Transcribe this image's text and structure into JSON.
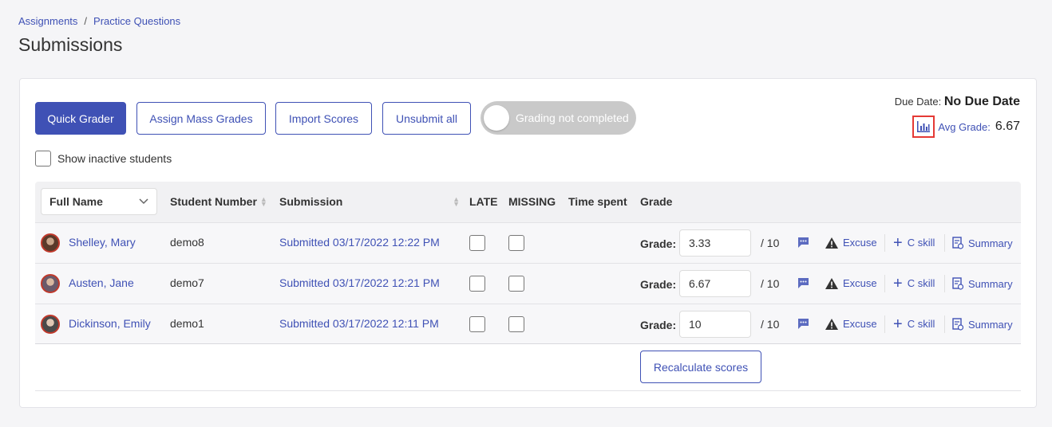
{
  "breadcrumb": {
    "item1": "Assignments",
    "sep": "/",
    "item2": "Practice Questions"
  },
  "page": {
    "title": "Submissions"
  },
  "toolbar": {
    "quick_grader": "Quick Grader",
    "assign_mass": "Assign Mass Grades",
    "import_scores": "Import Scores",
    "unsubmit_all": "Unsubmit all",
    "toggle_label": "Grading not completed"
  },
  "due": {
    "label": "Due Date:",
    "value": "No Due Date"
  },
  "avg": {
    "label": "Avg Grade:",
    "value": "6.67"
  },
  "inactive_label": "Show inactive students",
  "columns": {
    "full_name": "Full Name",
    "student_number": "Student Number",
    "submission": "Submission",
    "late": "LATE",
    "missing": "MISSING",
    "time_spent": "Time spent",
    "grade": "Grade"
  },
  "rows": [
    {
      "name": "Shelley, Mary",
      "number": "demo8",
      "submission": "Submitted 03/17/2022 12:22 PM",
      "grade_label": "Grade:",
      "grade": "3.33",
      "out_of": "/ 10",
      "excuse": "Excuse",
      "cskill": "C skill",
      "summary": "Summary"
    },
    {
      "name": "Austen, Jane",
      "number": "demo7",
      "submission": "Submitted 03/17/2022 12:21 PM",
      "grade_label": "Grade:",
      "grade": "6.67",
      "out_of": "/ 10",
      "excuse": "Excuse",
      "cskill": "C skill",
      "summary": "Summary"
    },
    {
      "name": "Dickinson, Emily",
      "number": "demo1",
      "submission": "Submitted 03/17/2022 12:11 PM",
      "grade_label": "Grade:",
      "grade": "10",
      "out_of": "/ 10",
      "excuse": "Excuse",
      "cskill": "C skill",
      "summary": "Summary"
    }
  ],
  "recalculate": "Recalculate scores",
  "colors": {
    "primary": "#3f51b5",
    "highlight": "#e53935",
    "toggle_off": "#c9c9c9"
  }
}
